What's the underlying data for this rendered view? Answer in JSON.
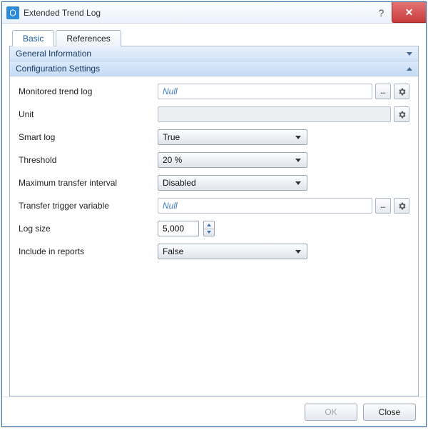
{
  "window": {
    "title": "Extended Trend Log"
  },
  "tabs": {
    "basic": "Basic",
    "references": "References"
  },
  "sections": {
    "general": "General Information",
    "config": "Configuration Settings"
  },
  "labels": {
    "monitored": "Monitored trend log",
    "unit": "Unit",
    "smartlog": "Smart log",
    "threshold": "Threshold",
    "maxtransfer": "Maximum transfer interval",
    "trigger": "Transfer trigger variable",
    "logsize": "Log size",
    "includereports": "Include in reports"
  },
  "values": {
    "monitored": "Null",
    "unit": "",
    "smartlog": "True",
    "threshold": "20 %",
    "maxtransfer": "Disabled",
    "trigger": "Null",
    "logsize": "5,000",
    "includereports": "False",
    "browse": "..."
  },
  "buttons": {
    "ok": "OK",
    "close": "Close"
  }
}
